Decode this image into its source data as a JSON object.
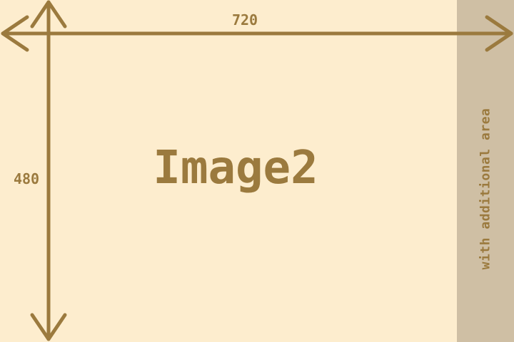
{
  "placeholder": {
    "main_label": "Image2",
    "width_value": "720",
    "height_value": "480",
    "side_label": "with additional area"
  },
  "colors": {
    "background": "#FDEDCE",
    "side_panel": "#CFBFA4",
    "ink": "#9B7A3E"
  }
}
